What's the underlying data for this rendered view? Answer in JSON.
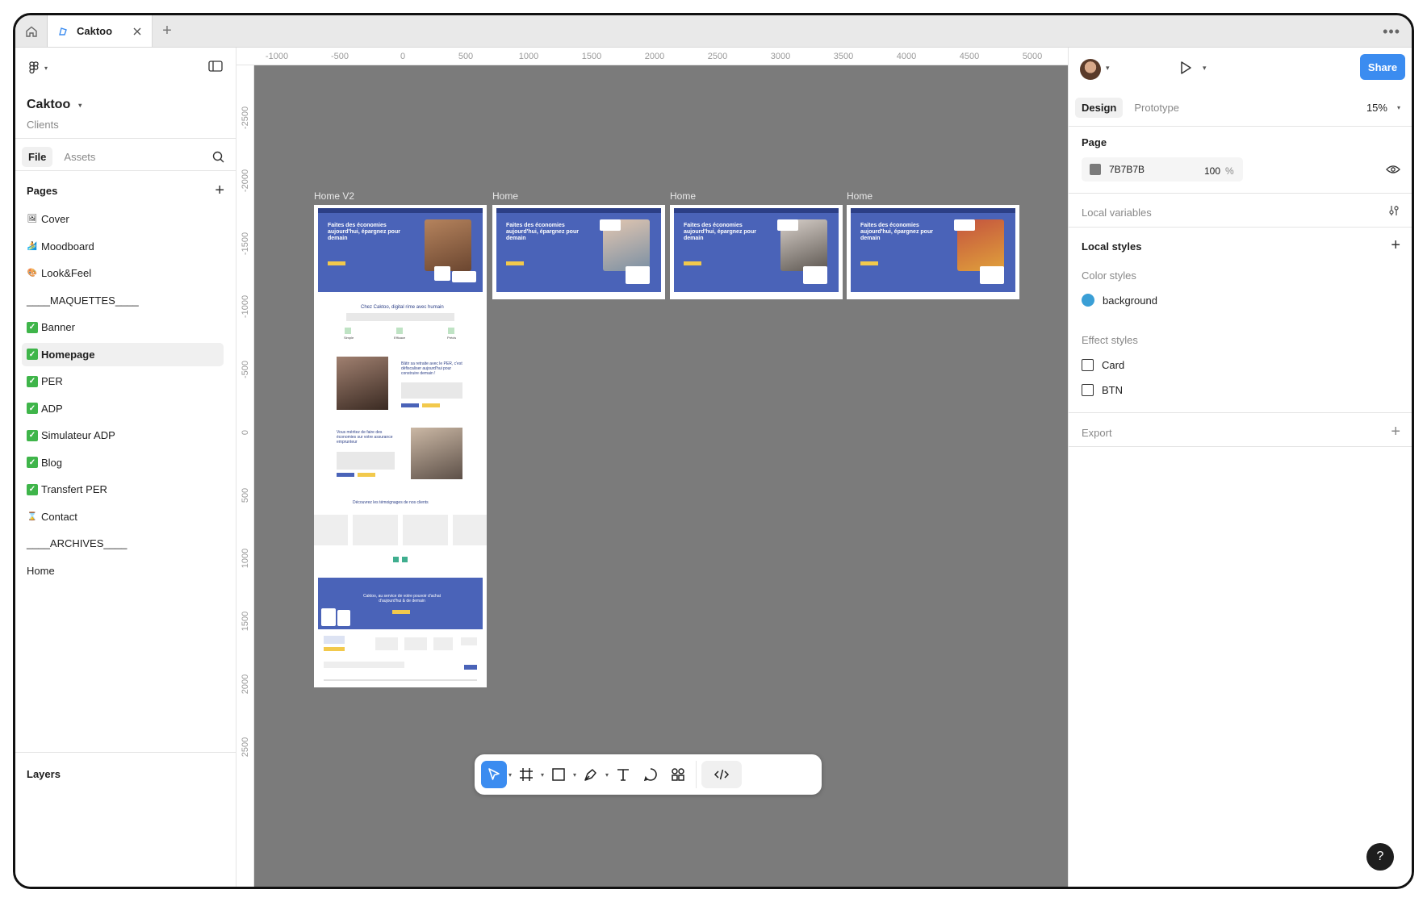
{
  "tabbar": {
    "tab_title": "Caktoo",
    "add": "+",
    "more": "•••"
  },
  "file": {
    "name": "Caktoo",
    "project": "Clients"
  },
  "left_tabs": {
    "file": "File",
    "assets": "Assets"
  },
  "pages": {
    "header": "Pages",
    "items": [
      {
        "label": "Cover",
        "icon": "🖼"
      },
      {
        "label": "Moodboard",
        "icon": "🏄"
      },
      {
        "label": "Look&Feel",
        "icon": "🎨"
      },
      {
        "label": "____MAQUETTES____",
        "icon": ""
      },
      {
        "label": "Banner",
        "icon": "✓"
      },
      {
        "label": "Homepage",
        "icon": "✓",
        "selected": true
      },
      {
        "label": "PER",
        "icon": "✓"
      },
      {
        "label": "ADP",
        "icon": "✓"
      },
      {
        "label": "Simulateur ADP",
        "icon": "✓"
      },
      {
        "label": "Blog",
        "icon": "✓"
      },
      {
        "label": "Transfert PER",
        "icon": "✓"
      },
      {
        "label": "Contact",
        "icon": "⌛"
      },
      {
        "label": "____ARCHIVES____",
        "icon": ""
      },
      {
        "label": "Home",
        "icon": ""
      }
    ]
  },
  "layers": {
    "header": "Layers"
  },
  "ruler_top": [
    "-1000",
    "-500",
    "0",
    "500",
    "1000",
    "1500",
    "2000",
    "2500",
    "3000",
    "3500",
    "4000",
    "4500",
    "5000"
  ],
  "ruler_left": [
    "-2500",
    "-2000",
    "-1500",
    "-1000",
    "-500",
    "0",
    "500",
    "1000",
    "1500",
    "2000",
    "2500"
  ],
  "canvas": {
    "frames": [
      {
        "label": "Home V2"
      },
      {
        "label": "Home"
      },
      {
        "label": "Home"
      },
      {
        "label": "Home"
      }
    ],
    "hero_headline": "Faites des économies aujourd'hui, épargnez pour demain",
    "section_titles": [
      "Chez Caktoo, digital rime avec humain",
      "Bâtir sa retraite avec le PER, c'est défiscaliser aujourd'hui pour construire demain !",
      "Vous méritez de faire des économies sur votre assurance emprunteur",
      "Découvrez les témoignages de nos clients",
      "Caktoo, au service de votre pouvoir d'achat d'aujourd'hui & de demain"
    ],
    "steps": [
      "Simple",
      "Efficace",
      "Précis"
    ],
    "bg_color": "#7B7B7B"
  },
  "right": {
    "share": "Share",
    "tabs": {
      "design": "Design",
      "prototype": "Prototype"
    },
    "zoom": "15%",
    "page": {
      "header": "Page",
      "fill_hex": "7B7B7B",
      "fill_color": "#7B7B7B",
      "opacity": "100",
      "percent": "%"
    },
    "local_variables": "Local variables",
    "local_styles": "Local styles",
    "color_styles": {
      "header": "Color styles",
      "items": [
        {
          "name": "background",
          "color": "#3a9fd6"
        }
      ]
    },
    "effect_styles": {
      "header": "Effect styles",
      "items": [
        "Card",
        "BTN"
      ]
    },
    "export": "Export"
  },
  "help": "?"
}
